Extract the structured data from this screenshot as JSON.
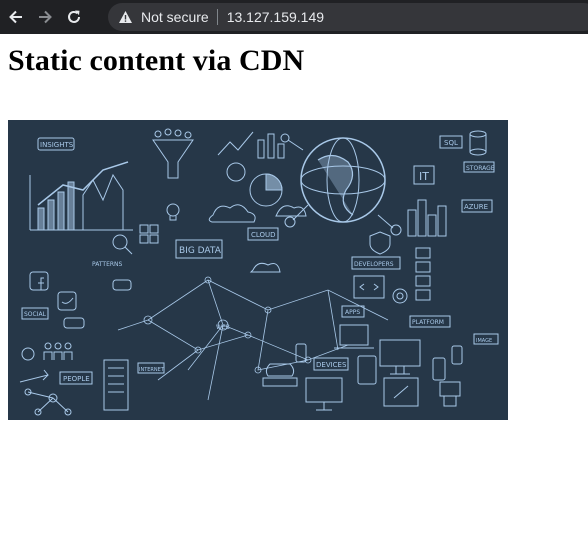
{
  "browser": {
    "security_label": "Not secure",
    "url": "13.127.159.149",
    "icons": {
      "back": "back-arrow-icon",
      "forward": "forward-arrow-icon",
      "reload": "reload-icon",
      "warning": "warning-triangle-icon"
    }
  },
  "page": {
    "heading": "Static content via CDN",
    "hero": {
      "background": "#263748",
      "line_color": "#a8c8e8",
      "labels": {
        "insights": "INSIGHTS",
        "big_data": "BIG DATA",
        "cloud": "CLOUD",
        "patterns": "PATTERNS",
        "developers": "DEVELOPERS",
        "platform": "PLATFORM",
        "apps": "APPS",
        "devices": "DEVICES",
        "people": "PEOPLE",
        "social": "SOCIAL",
        "sql": "SQL",
        "storage": "STORAGE",
        "azure": "AZURE",
        "it": "IT",
        "image": "IMAGE",
        "web": "WEB",
        "internet": "INTERNET"
      }
    }
  }
}
